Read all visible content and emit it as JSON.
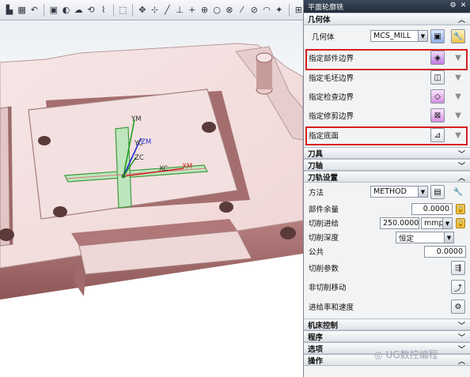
{
  "panel": {
    "title": "平面轮廓铣",
    "settings_icon": "gear-icon",
    "close_icon": "close-icon",
    "geometry": {
      "section_label": "几何体",
      "geometry_label": "几何体",
      "geometry_value": "MCS_MILL",
      "rows": [
        {
          "label": "指定部件边界",
          "highlighted": true
        },
        {
          "label": "指定毛坯边界",
          "highlighted": false
        },
        {
          "label": "指定检查边界",
          "highlighted": false
        },
        {
          "label": "指定修剪边界",
          "highlighted": false
        },
        {
          "label": "指定底面",
          "highlighted": true
        }
      ]
    },
    "tool_section": "刀具",
    "axis_section": "刀轴",
    "path_settings": {
      "section_label": "刀轨设置",
      "method_label": "方法",
      "method_value": "METHOD",
      "part_stock_label": "部件余量",
      "part_stock_value": "0.0000",
      "feed_label": "切削进给",
      "feed_value": "250.0000",
      "feed_unit": "mmpr",
      "depth_label": "切削深度",
      "depth_value": "恒定",
      "common_label": "公共",
      "common_value": "0.0000",
      "cut_params_label": "切削参数",
      "non_cut_label": "非切削移动",
      "feeds_speeds_label": "进给率和速度"
    },
    "machine_control_section": "机床控制",
    "program_section": "程序",
    "options_section": "选项",
    "actions_section": "操作"
  },
  "viewport": {
    "axis_labels": {
      "ym": "YM",
      "yc": "YC",
      "zm": "ZM",
      "zc": "ZC",
      "xc": "XC",
      "xm": "XM"
    },
    "part_color": "#f2dede",
    "highlight_color": "#d62020"
  },
  "watermark": {
    "text": "UG数控编程"
  }
}
